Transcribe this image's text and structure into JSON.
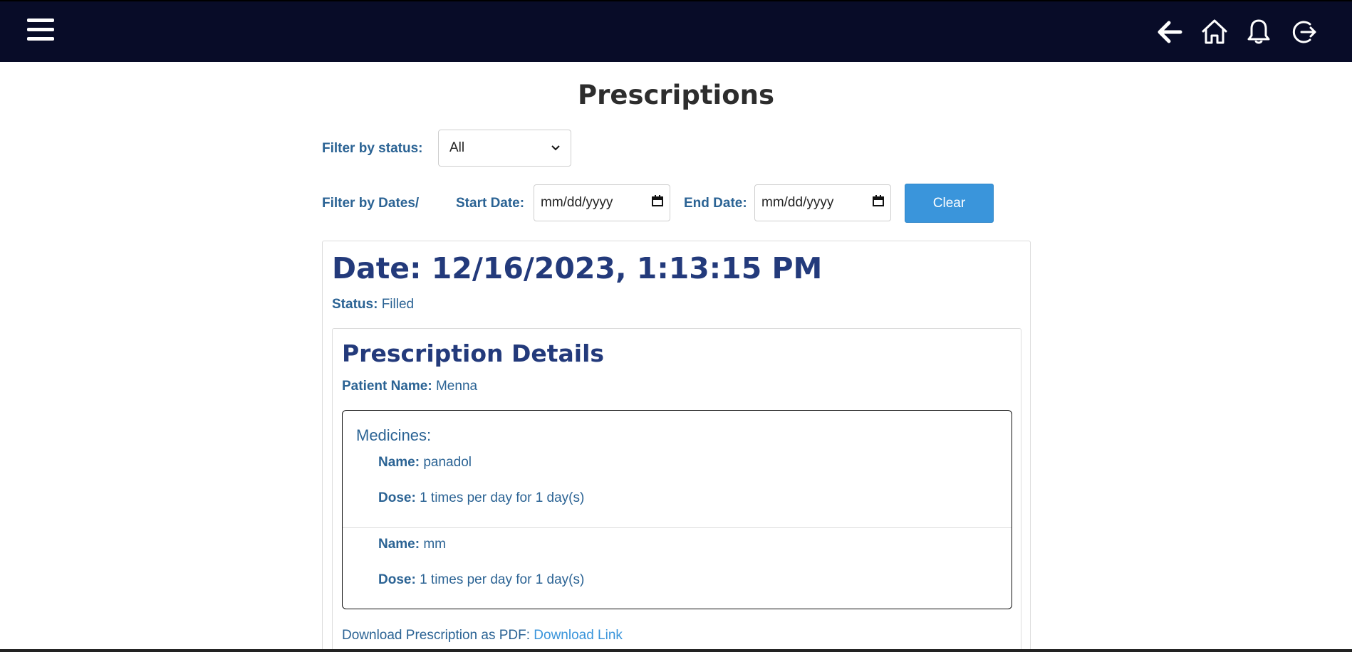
{
  "header": {
    "menu_icon": "hamburger-menu-icon",
    "actions": [
      "back-arrow-icon",
      "home-icon",
      "bell-icon",
      "logout-icon"
    ]
  },
  "page_title": "Prescriptions",
  "filters": {
    "status_label": "Filter by status:",
    "status_value": "All",
    "dates_label": "Filter by Dates/",
    "start_label": "Start Date:",
    "start_value": "mm/dd/yyyy",
    "end_label": "End Date:",
    "end_value": "mm/dd/yyyy",
    "clear_label": "Clear"
  },
  "prescription": {
    "date": "Date: 12/16/2023, 1:13:15 PM",
    "status_label": "Status:",
    "status_value": "Filled",
    "details_title": "Prescription Details",
    "patient_label": "Patient Name:",
    "patient_value": "Menna",
    "medicines_title": "Medicines:",
    "medicines": [
      {
        "name_label": "Name:",
        "name": "panadol",
        "dose_label": "Dose:",
        "dose": "1 times per day for 1 day(s)"
      },
      {
        "name_label": "Name:",
        "name": "mm",
        "dose_label": "Dose:",
        "dose": "1 times per day for 1 day(s)"
      }
    ],
    "download_text": "Download Prescription as PDF:",
    "download_link": "Download Link"
  },
  "colors": {
    "navbar": "#080c28",
    "heading": "#233a7b",
    "text": "#2b6394",
    "accent": "#3a95db"
  }
}
